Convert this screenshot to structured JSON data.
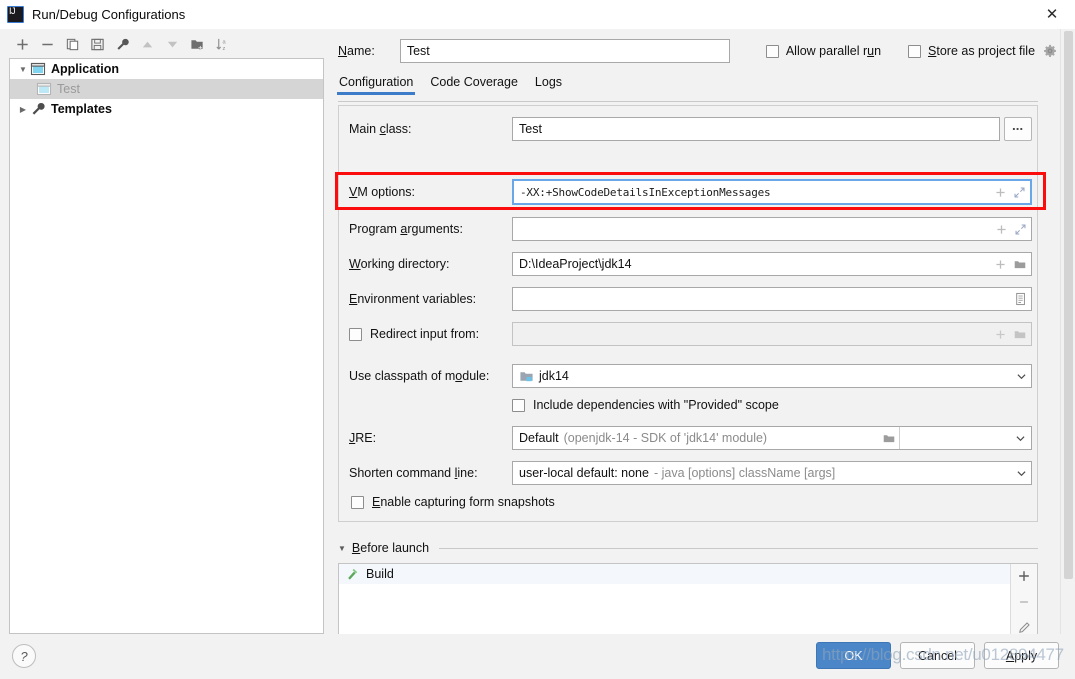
{
  "window": {
    "title": "Run/Debug Configurations",
    "close_label": "✕",
    "app_icon": "intellij-idea-icon"
  },
  "left_toolbar": {
    "buttons": [
      {
        "name": "add-configuration-button",
        "icon": "plus-icon",
        "label": "+"
      },
      {
        "name": "remove-configuration-button",
        "icon": "minus-icon",
        "label": "−"
      },
      {
        "name": "copy-configuration-button",
        "icon": "copy-icon",
        "label": ""
      },
      {
        "name": "save-configuration-button",
        "icon": "save-icon",
        "label": ""
      },
      {
        "name": "edit-templates-button",
        "icon": "wrench-icon",
        "label": ""
      },
      {
        "name": "move-up-button",
        "icon": "arrow-up-icon",
        "label": ""
      },
      {
        "name": "move-down-button",
        "icon": "arrow-down-icon",
        "label": ""
      },
      {
        "name": "new-folder-button",
        "icon": "folder-add-icon",
        "label": ""
      },
      {
        "name": "sort-configurations-button",
        "icon": "sort-az-icon",
        "label": ""
      }
    ]
  },
  "tree": {
    "nodes": [
      {
        "label": "Application",
        "icon": "application-icon",
        "twisty": "▼",
        "indent": 0,
        "selected": false,
        "dim": false,
        "bold": true
      },
      {
        "label": "Test",
        "icon": "application-icon",
        "twisty": "",
        "indent": 1,
        "selected": true,
        "dim": true,
        "bold": false
      },
      {
        "label": "Templates",
        "icon": "wrench-icon",
        "twisty": "▶",
        "indent": 0,
        "selected": false,
        "dim": false,
        "bold": true
      }
    ]
  },
  "header": {
    "name_label": "Name:",
    "name_value": "Test",
    "name_placeholder": "",
    "allow_parallel_run_label": "Allow parallel run",
    "allow_parallel_run_checked": false,
    "store_as_project_file_label": "Store as project file",
    "store_as_project_file_checked": false,
    "gear_icon": "gear-icon"
  },
  "tabs": [
    {
      "label": "Configuration",
      "active": true
    },
    {
      "label": "Code Coverage",
      "active": false
    },
    {
      "label": "Logs",
      "active": false
    }
  ],
  "form": {
    "main_class": {
      "label": "Main class:",
      "value": "Test",
      "browse_label": "…"
    },
    "vm_options": {
      "label": "VM options:",
      "value": "-XX:+ShowCodeDetailsInExceptionMessages",
      "focused": true,
      "highlight_color": "#fb0d0d",
      "focus_border_color": "#6aa7e8",
      "expand_icon": "expand-icon",
      "macro_icon": "plus-icon"
    },
    "program_arguments": {
      "label": "Program arguments:",
      "value": "",
      "expand_icon": "expand-icon",
      "macro_icon": "plus-icon"
    },
    "working_directory": {
      "label": "Working directory:",
      "value": "D:\\IdeaProject\\jdk14",
      "browse_icon": "folder-icon",
      "macro_icon": "plus-icon"
    },
    "environment_variables": {
      "label": "Environment variables:",
      "value": "",
      "browse_icon": "list-edit-icon"
    },
    "redirect_input": {
      "label": "Redirect input from:",
      "checked": false,
      "value": "",
      "browse_icon": "folder-icon",
      "macro_icon": "plus-icon"
    },
    "classpath_module": {
      "label": "Use classpath of module:",
      "value": "jdk14",
      "icon": "module-icon",
      "caret": "▾"
    },
    "include_provided": {
      "label": "Include dependencies with \"Provided\" scope",
      "checked": false
    },
    "jre": {
      "label": "JRE:",
      "value": "Default",
      "value_detail": "(openjdk-14 - SDK of 'jdk14' module)",
      "browse_icon": "folder-icon",
      "caret": "▾"
    },
    "shorten_command_line": {
      "label": "Shorten command line:",
      "value": "user-local default: none",
      "value_detail": "- java [options] className [args]",
      "caret": "▾"
    },
    "enable_form_snapshots": {
      "label": "Enable capturing form snapshots",
      "checked": false
    }
  },
  "before_launch": {
    "header_label": "Before launch",
    "twisty": "▼",
    "items": [
      {
        "label": "Build",
        "icon": "build-hammer-icon"
      }
    ],
    "side_buttons": [
      {
        "name": "before-launch-add-button",
        "icon": "plus-icon",
        "label": "+"
      },
      {
        "name": "before-launch-remove-button",
        "icon": "minus-icon",
        "label": "−"
      },
      {
        "name": "before-launch-edit-button",
        "icon": "pencil-icon",
        "label": ""
      },
      {
        "name": "before-launch-move-up-button",
        "icon": "arrow-up-icon",
        "label": ""
      }
    ]
  },
  "bottom": {
    "help_label": "?",
    "ok_label": "OK",
    "cancel_label": "Cancel",
    "apply_label": "Apply"
  },
  "watermark": {
    "text": "https://blog.csdn.net/u012894477"
  }
}
